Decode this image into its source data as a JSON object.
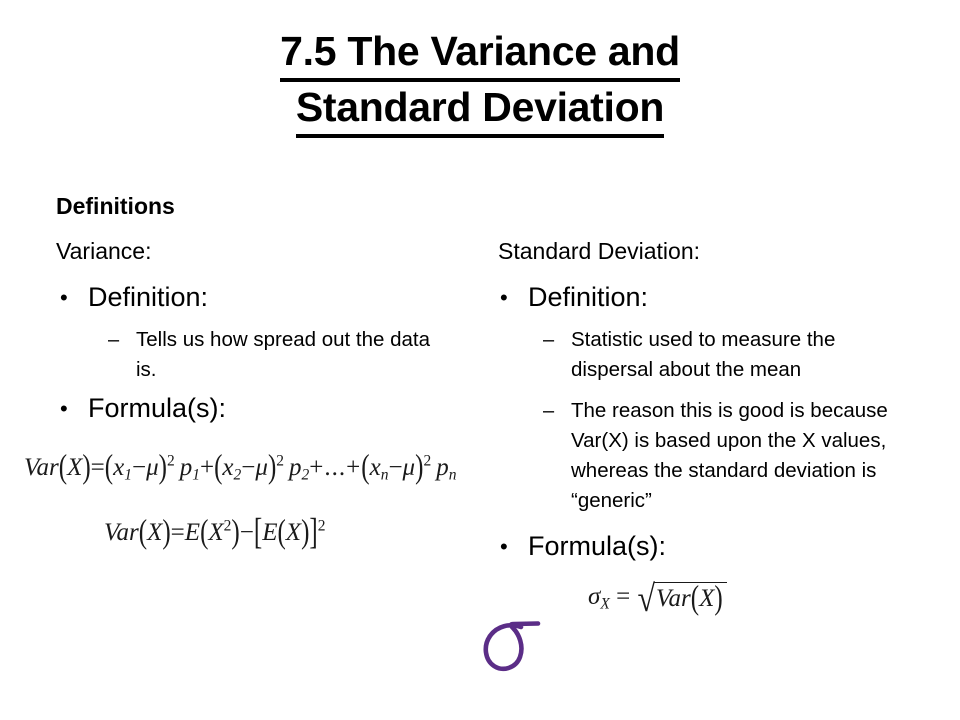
{
  "slide": {
    "title_line1": "7.5 The Variance and",
    "title_line2": "Standard Deviation",
    "section_label": "Definitions",
    "background_color": "#ffffff",
    "text_color": "#000000",
    "accent_color": "#5b2d87"
  },
  "left_column": {
    "heading": "Variance:",
    "bullet1_mark": "•",
    "bullet1_label": "Definition:",
    "bullet1_sub_mark": "–",
    "bullet1_sub_text": "Tells us how spread out the data is.",
    "bullet2_mark": "•",
    "bullet2_label": "Formula(s):",
    "formula1": {
      "lhs": "Var",
      "eq": "=",
      "plain": "Var(X) = (x1 – μ)² p1 + (x2 – μ)² p2 + ... + (xn – μ)² pn",
      "var_sym": "X",
      "x1": "x",
      "x1_sub": "1",
      "x2": "x",
      "x2_sub": "2",
      "xn": "x",
      "xn_sub": "n",
      "mu": "μ",
      "exp": "2",
      "p1": "p",
      "p1_sub": "1",
      "p2": "p",
      "p2_sub": "2",
      "pn": "p",
      "pn_sub": "n",
      "plus": "+",
      "minus": "−",
      "ellipsis": "+...+"
    },
    "formula2": {
      "plain": "Var(X) = E(X²) – [E(X)]²",
      "lhs": "Var",
      "eq": "=",
      "var_sym": "X",
      "E": "E",
      "exp2": "2",
      "minus": "−"
    }
  },
  "right_column": {
    "heading": "Standard Deviation:",
    "bullet1_mark": "•",
    "bullet1_label": "Definition:",
    "bullet1_sub1_mark": "–",
    "bullet1_sub1_text": "Statistic used to measure the dispersal about the mean",
    "bullet1_sub2_mark": "–",
    "bullet1_sub2_text": "The reason this is good is because Var(X) is based upon the X values, whereas the standard deviation is “generic”",
    "bullet2_mark": "•",
    "bullet2_label": "Formula(s):",
    "formula1": {
      "plain": "σX = √Var(X)",
      "sigma": "σ",
      "sigma_sub": "X",
      "eq": "=",
      "radical": "√",
      "lhs": "Var",
      "var_sym": "X"
    }
  },
  "annotation": {
    "sigma_symbol": "σ",
    "sigma_color": "#5b2d87"
  }
}
